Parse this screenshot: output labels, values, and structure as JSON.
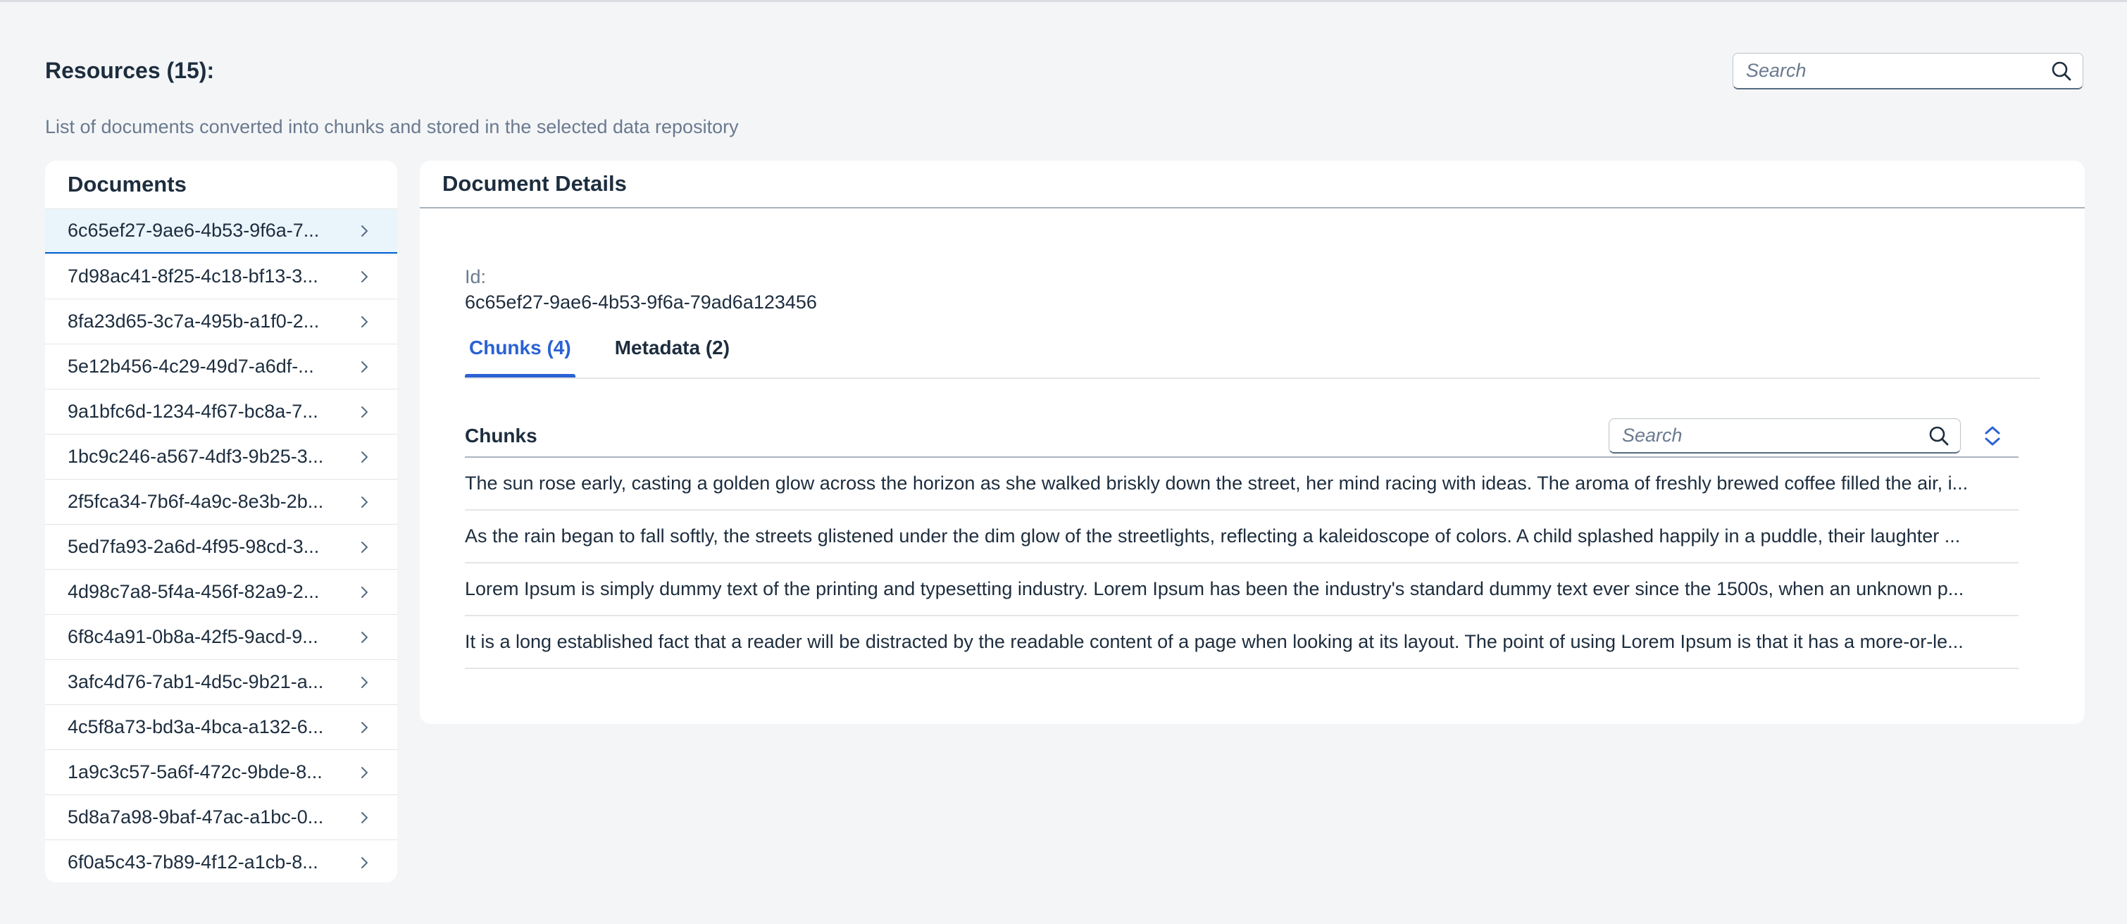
{
  "header": {
    "title": "Resources (15):",
    "subtitle": "List of documents converted into chunks and stored in the selected data repository",
    "search_placeholder": "Search"
  },
  "documents": {
    "title": "Documents",
    "selected_index": 0,
    "items": [
      {
        "label": "6c65ef27-9ae6-4b53-9f6a-7..."
      },
      {
        "label": "7d98ac41-8f25-4c18-bf13-3..."
      },
      {
        "label": "8fa23d65-3c7a-495b-a1f0-2..."
      },
      {
        "label": "5e12b456-4c29-49d7-a6df-..."
      },
      {
        "label": "9a1bfc6d-1234-4f67-bc8a-7..."
      },
      {
        "label": "1bc9c246-a567-4df3-9b25-3..."
      },
      {
        "label": "2f5fca34-7b6f-4a9c-8e3b-2b..."
      },
      {
        "label": "5ed7fa93-2a6d-4f95-98cd-3..."
      },
      {
        "label": "4d98c7a8-5f4a-456f-82a9-2..."
      },
      {
        "label": "6f8c4a91-0b8a-42f5-9acd-9..."
      },
      {
        "label": "3afc4d76-7ab1-4d5c-9b21-a..."
      },
      {
        "label": "4c5f8a73-bd3a-4bca-a132-6..."
      },
      {
        "label": "1a9c3c57-5a6f-472c-9bde-8..."
      },
      {
        "label": "5d8a7a98-9baf-47ac-a1bc-0..."
      },
      {
        "label": "6f0a5c43-7b89-4f12-a1cb-8..."
      }
    ]
  },
  "details": {
    "title": "Document Details",
    "id_label": "Id:",
    "id_value": "6c65ef27-9ae6-4b53-9f6a-79ad6a123456",
    "tabs": [
      {
        "label": "Chunks (4)",
        "active": true
      },
      {
        "label": "Metadata (2)",
        "active": false
      }
    ],
    "chunks": {
      "title": "Chunks",
      "search_placeholder": "Search",
      "rows": [
        {
          "text": "The sun rose early, casting a golden glow across the horizon as she walked briskly down the street, her mind racing with ideas. The aroma of freshly brewed coffee filled the air, i..."
        },
        {
          "text": "As the rain began to fall softly, the streets glistened under the dim glow of the streetlights, reflecting a kaleidoscope of colors. A child splashed happily in a puddle, their laughter ..."
        },
        {
          "text": "Lorem Ipsum is simply dummy text of the printing and typesetting industry. Lorem Ipsum has been the industry's standard dummy text ever since the 1500s, when an unknown p..."
        },
        {
          "text": "It is a long established fact that a reader will be distracted by the readable content of a page when looking at its layout. The point of using Lorem Ipsum is that it has a more-or-le..."
        }
      ]
    }
  },
  "colors": {
    "accent": "#2b62d3",
    "selected_bg": "#eaf4fb",
    "page_bg": "#f4f5f7",
    "muted_text": "#6a7a8f"
  }
}
